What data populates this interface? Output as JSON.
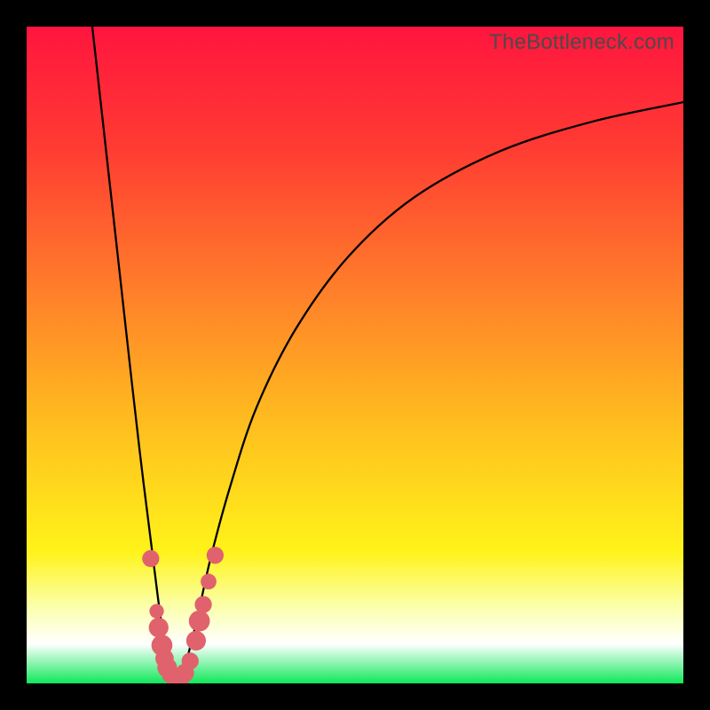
{
  "watermark": "TheBottleneck.com",
  "colors": {
    "top": "#ff153e",
    "upper": "#ff3a33",
    "mid1": "#ff7e2a",
    "mid2": "#ffc21e",
    "band": "#fff31a",
    "pale": "#fbffa6",
    "white": "#ffffff",
    "bottom": "#10e85a"
  },
  "chart_data": {
    "type": "line",
    "title": "",
    "xlabel": "",
    "ylabel": "",
    "xlim": [
      0,
      100
    ],
    "ylim": [
      0,
      100
    ],
    "grid": false,
    "curve_left": {
      "x": [
        10,
        12,
        14,
        16,
        17.5,
        19,
        20,
        20.8,
        21.3,
        21.8,
        22.3
      ],
      "y": [
        100,
        82,
        64,
        46,
        33,
        21,
        13,
        7,
        4,
        2,
        0.5
      ]
    },
    "curve_right": {
      "x": [
        23.5,
        24.5,
        26,
        28,
        31,
        35,
        41,
        49,
        59,
        72,
        86,
        100
      ],
      "y": [
        0.5,
        4,
        10,
        19,
        30,
        42,
        54,
        65,
        74,
        81,
        85.5,
        88.5
      ]
    },
    "markers": [
      {
        "x": 18.9,
        "y": 19,
        "r": 1.3
      },
      {
        "x": 19.8,
        "y": 11,
        "r": 1.1
      },
      {
        "x": 20.1,
        "y": 8.5,
        "r": 1.5
      },
      {
        "x": 20.6,
        "y": 5.8,
        "r": 1.6
      },
      {
        "x": 21.0,
        "y": 3.8,
        "r": 1.4
      },
      {
        "x": 21.4,
        "y": 2.4,
        "r": 1.5
      },
      {
        "x": 21.9,
        "y": 1.3,
        "r": 1.3
      },
      {
        "x": 22.6,
        "y": 0.6,
        "r": 1.3
      },
      {
        "x": 23.4,
        "y": 0.6,
        "r": 1.3
      },
      {
        "x": 24.1,
        "y": 1.6,
        "r": 1.4
      },
      {
        "x": 24.9,
        "y": 3.4,
        "r": 1.3
      },
      {
        "x": 25.8,
        "y": 6.5,
        "r": 1.5
      },
      {
        "x": 26.3,
        "y": 9.5,
        "r": 1.6
      },
      {
        "x": 26.9,
        "y": 12,
        "r": 1.3
      },
      {
        "x": 27.7,
        "y": 15.5,
        "r": 1.2
      },
      {
        "x": 28.7,
        "y": 19.5,
        "r": 1.3
      }
    ]
  }
}
